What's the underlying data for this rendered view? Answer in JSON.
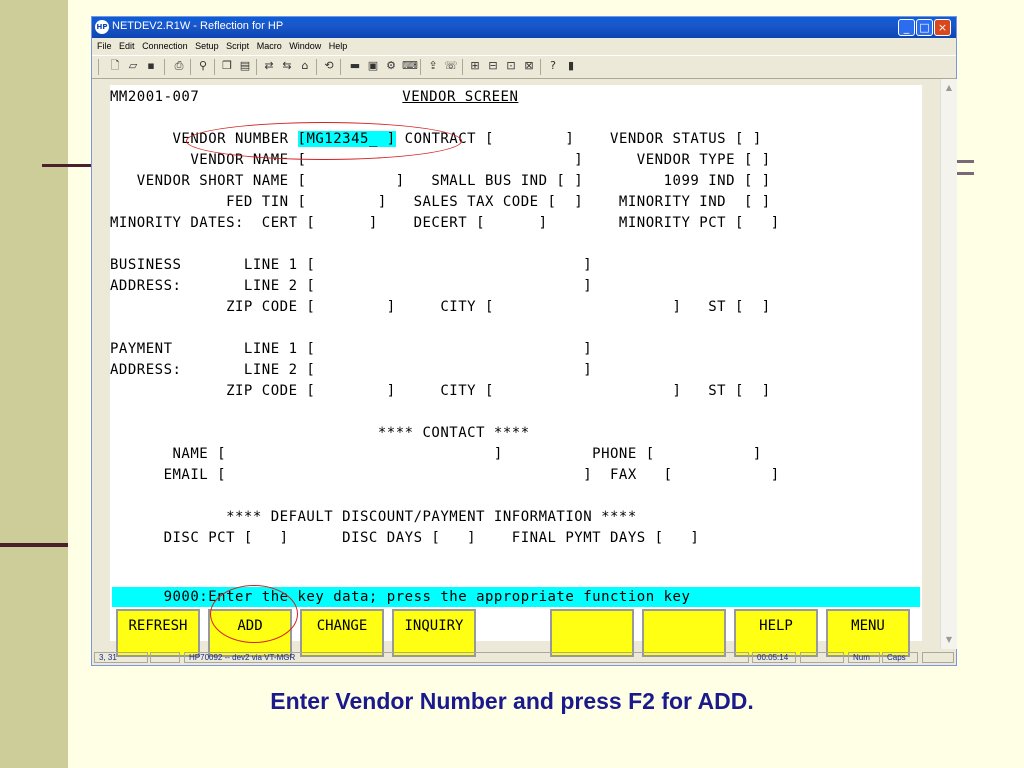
{
  "window": {
    "title": "NETDEV2.R1W - Reflection for HP",
    "app_icon": "HP",
    "menu": [
      "File",
      "Edit",
      "Connection",
      "Setup",
      "Script",
      "Macro",
      "Window",
      "Help"
    ]
  },
  "terminal": {
    "lines": [
      "MM2001-007",
      "",
      "       VENDOR NUMBER ",
      "         VENDOR NAME [                              ]      VENDOR TYPE [ ]",
      "   VENDOR SHORT NAME [          ]   SMALL BUS IND [ ]         1099 IND [ ]",
      "             FED TIN [        ]   SALES TAX CODE [  ]    MINORITY IND  [ ]",
      "MINORITY DATES:  CERT [      ]    DECERT [      ]        MINORITY PCT [   ]",
      "",
      "BUSINESS       LINE 1 [                              ]",
      "ADDRESS:       LINE 2 [                              ]",
      "             ZIP CODE [        ]     CITY [                    ]   ST [  ]",
      "",
      "PAYMENT        LINE 1 [                              ]",
      "ADDRESS:       LINE 2 [                              ]",
      "             ZIP CODE [        ]     CITY [                    ]   ST [  ]",
      "",
      "                              **** CONTACT ****",
      "       NAME [                              ]          PHONE [           ]",
      "      EMAIL [                                        ]  FAX   [           ]",
      "",
      "             **** DEFAULT DISCOUNT/PAYMENT INFORMATION ****",
      "      DISC PCT [   ]      DISC DAYS [   ]    FINAL PYMT DAYS [   ]"
    ],
    "screen_title": "VENDOR SCREEN",
    "vendor_number_value": "[MG12345_ ]",
    "vendor_number_rest": " CONTRACT [        ]    VENDOR STATUS [ ]",
    "message": "      9000:Enter the key data; press the appropriate function key"
  },
  "function_keys": [
    {
      "label": "REFRESH"
    },
    {
      "label": "ADD"
    },
    {
      "label": "CHANGE"
    },
    {
      "label": "INQUIRY"
    },
    {
      "label": ""
    },
    {
      "label": ""
    },
    {
      "label": ""
    },
    {
      "label": "HELP"
    },
    {
      "label": "MENU"
    }
  ],
  "status_bar": {
    "cursor": "3, 31",
    "session": "HP70092 -- dev2 via VT-MGR",
    "time": "00:05:14",
    "num": "Num",
    "caps": "Caps"
  },
  "caption": "Enter Vendor Number and press F2 for ADD.",
  "colors": {
    "key_background": "#ffff14",
    "highlight": "#00ffff",
    "annotation": "#d42020",
    "caption": "#1a1a8c"
  }
}
